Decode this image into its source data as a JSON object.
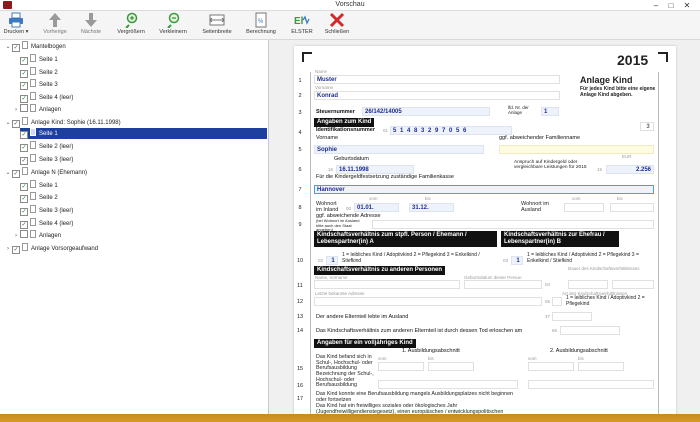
{
  "window": {
    "title": "Vorschau"
  },
  "toolbar": {
    "print": "Drucken",
    "prev": "Vorherige",
    "next": "Nächste",
    "zoom_in": "Vergrößern",
    "zoom_out": "Verkleinern",
    "page_width": "Seitenbreite",
    "calc": "Berechnung",
    "elster": "ELSTER",
    "close": "Schließen"
  },
  "tree": [
    {
      "label": "Mantelbogen"
    },
    {
      "label": "Seite 1"
    },
    {
      "label": "Seite 2"
    },
    {
      "label": "Seite 3"
    },
    {
      "label": "Seite 4 (leer)"
    },
    {
      "label": "Anlagen"
    },
    {
      "label": "Anlage Kind: Sophie (16.11.1998)"
    },
    {
      "label": "Seite 1"
    },
    {
      "label": "Seite 2 (leer)"
    },
    {
      "label": "Seite 3 (leer)"
    },
    {
      "label": "Anlage N (Ehemann)"
    },
    {
      "label": "Seite 1"
    },
    {
      "label": "Seite 2"
    },
    {
      "label": "Seite 3 (leer)"
    },
    {
      "label": "Seite 4 (leer)"
    },
    {
      "label": "Anlagen"
    },
    {
      "label": "Anlage Vorsorgeaufwand"
    }
  ],
  "form": {
    "year": "2015",
    "title": "Anlage Kind",
    "subtitle": "Für jedes Kind bitte eine eigene Anlage Kind abgeben.",
    "name_hint": "Name",
    "name": "Muster",
    "firstname_hint": "Vorname",
    "firstname": "Konrad",
    "taxno_label": "Steuernummer",
    "taxno": "26/142/14005",
    "lfd_label": "lfd. Nr. der Anlage",
    "lfd": "1",
    "sec_child": "Angaben zum Kind",
    "idno_label": "Identifikationsnummer",
    "idno_code": "01",
    "idno": "5 1 4 8 3 2 9 7 0 5 6",
    "idno_box": "3",
    "vorname_label": "Vorname",
    "other_family_label": "ggf. abweichender Familienname",
    "child_firstname": "Sophie",
    "birth_label": "Geburtsdatum",
    "birth_code": "16",
    "birth": "16.11.1998",
    "kindergeld_label": "Anspruch auf Kindergeld oder vergleichbare Leistungen für 2015",
    "kindergeld_code": "15",
    "kindergeld_unit": "EUR",
    "kindergeld": "2.256",
    "familienkasse_label": "Für die Kindergeldfestsetzung zuständige Familienkasse",
    "familienkasse": "Hannover",
    "wohnort_label": "Wohnort im Inland",
    "wohnort_code": "00",
    "from": "01.01.",
    "to": "31.12.",
    "wohnort_ausland": "Wohnort im Ausland",
    "address_label": "ggf. abweichende Adresse",
    "address_hint": "(bei Wohnort im Ausland bitte auch den Staat angeben)",
    "sec_rel_a": "Kindschaftsverhältnis zum stpfl. Person / Ehemann / Lebenspartner(in) A",
    "rel_a_code": "02",
    "rel_a": "1",
    "rel_opts_a": "1 = leibliches Kind / Adoptivkind   2 = Pflegekind   3 = Enkelkind / Stiefkind",
    "sec_rel_b": "Kindschaftsverhältnis zur Ehefrau / Lebenspartner(in) B",
    "rel_b_code": "03",
    "rel_b": "1",
    "rel_opts_b": "1 = leibliches Kind / Adoptivkind   2 = Pflegekind   3 = Enkelkind / Stiefkind",
    "sec_other": "Kindschaftsverhältnis zu anderen Personen",
    "other_name_hint": "Name, Vorname",
    "other_birth_hint": "Geburtsdatum dieser Person",
    "other_dauer_hint": "Dauer des Kindschaftsverhältnisses",
    "other_addr_hint": "Letzte bekannte Adresse",
    "art_hint": "Art des Kindschaftsverhältnisses",
    "art_opts": "1 = leibliches Kind / Adoptivkind   2 = Pflegekind",
    "row12": "Der andere Elternteil lebte im Ausland",
    "row12_code": "37",
    "row13": "Das Kindschaftsverhältnis zum anderen Elternteil ist durch dessen Tod erloschen am",
    "row13_code": "66",
    "sec_adult": "Angaben für ein volljähriges Kind",
    "col1": "1. Ausbildungsabschnitt",
    "col2": "2. Ausbildungsabschnitt",
    "row15": "Das Kind befand sich in Schul-, Hochschul- oder Berufsausbildung",
    "row16": "Bezeichnung der Schul-, Hochschul- oder Berufsausbildung",
    "row17": "Das Kind konnte eine Berufsausbildung mangels Ausbildungsplatzes nicht beginnen oder fortsetzen",
    "row18": "Das Kind hat ein freiwilliges soziales oder ökologisches Jahr (Jugendfreiwilligendienstegesetz), einen europäischen / entwicklungspolitischen Freiwilligendienst"
  },
  "colors": {
    "selection": "#1f3f9e",
    "field": "#eef2fb",
    "field_text": "#1d2f8a",
    "taskbar": "#d59a25"
  }
}
